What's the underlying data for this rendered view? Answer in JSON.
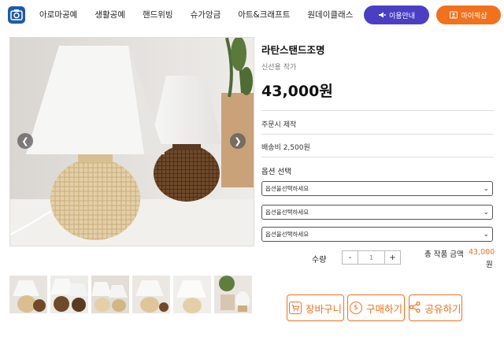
{
  "header": {
    "nav": [
      "아로마공예",
      "생활공예",
      "핸드위빙",
      "슈가앙금",
      "아트&크래프트",
      "원데이클래스"
    ],
    "info_button": "이용안내",
    "mypage_button": "마이픽샵"
  },
  "product": {
    "title": "라탄스탠드조명",
    "author": "신선용 작가",
    "price": "43,000원",
    "made_to_order": "주문시 제작",
    "shipping": "배송비 2,500원",
    "options_title": "옵션 선택",
    "options": [
      {
        "placeholder": "옵션을선택하세요"
      },
      {
        "placeholder": "옵션을선택하세요"
      },
      {
        "placeholder": "옵션을선택하세요"
      }
    ]
  },
  "quantity": {
    "label": "수량",
    "minus": "-",
    "value": "1",
    "plus": "+"
  },
  "total": {
    "label": "총 작품 금액",
    "amount": "43,000",
    "unit": "원"
  },
  "actions": {
    "cart": "장바구니",
    "buy": "구매하기",
    "share": "공유하기"
  },
  "colors": {
    "primary_purple": "#4a3fc4",
    "accent_orange": "#f2711c",
    "total_orange": "#e8702a"
  }
}
